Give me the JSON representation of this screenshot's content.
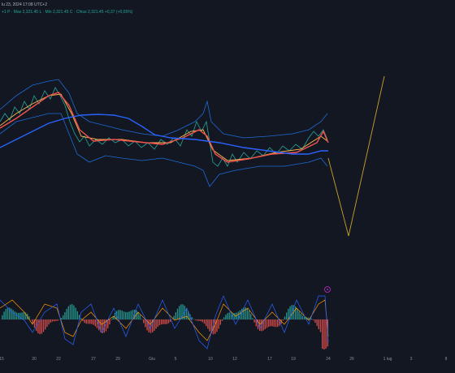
{
  "header": {
    "title_info": "lu 23, 2024 17:08 UTC+2",
    "ohlc_line": "+1  P · Max 2,321.45   L · Min 2,321.45   C · Chius 2,321.45  +0,37 (+0,05%)"
  },
  "x_axis": {
    "ticks": [
      "15",
      "20",
      "22",
      "27",
      "29",
      "Giu",
      "5",
      "10",
      "12",
      "17",
      "19",
      "24",
      "26",
      "1 lug",
      "3",
      "8"
    ]
  },
  "colors": {
    "background": "#131722",
    "ma_red": "#ef5350",
    "ma_blue": "#2962ff",
    "ma_orange": "#ffb74d",
    "forecast": "#c9a227",
    "hist_up": "#26a69a",
    "hist_down": "#ef5350"
  }
}
